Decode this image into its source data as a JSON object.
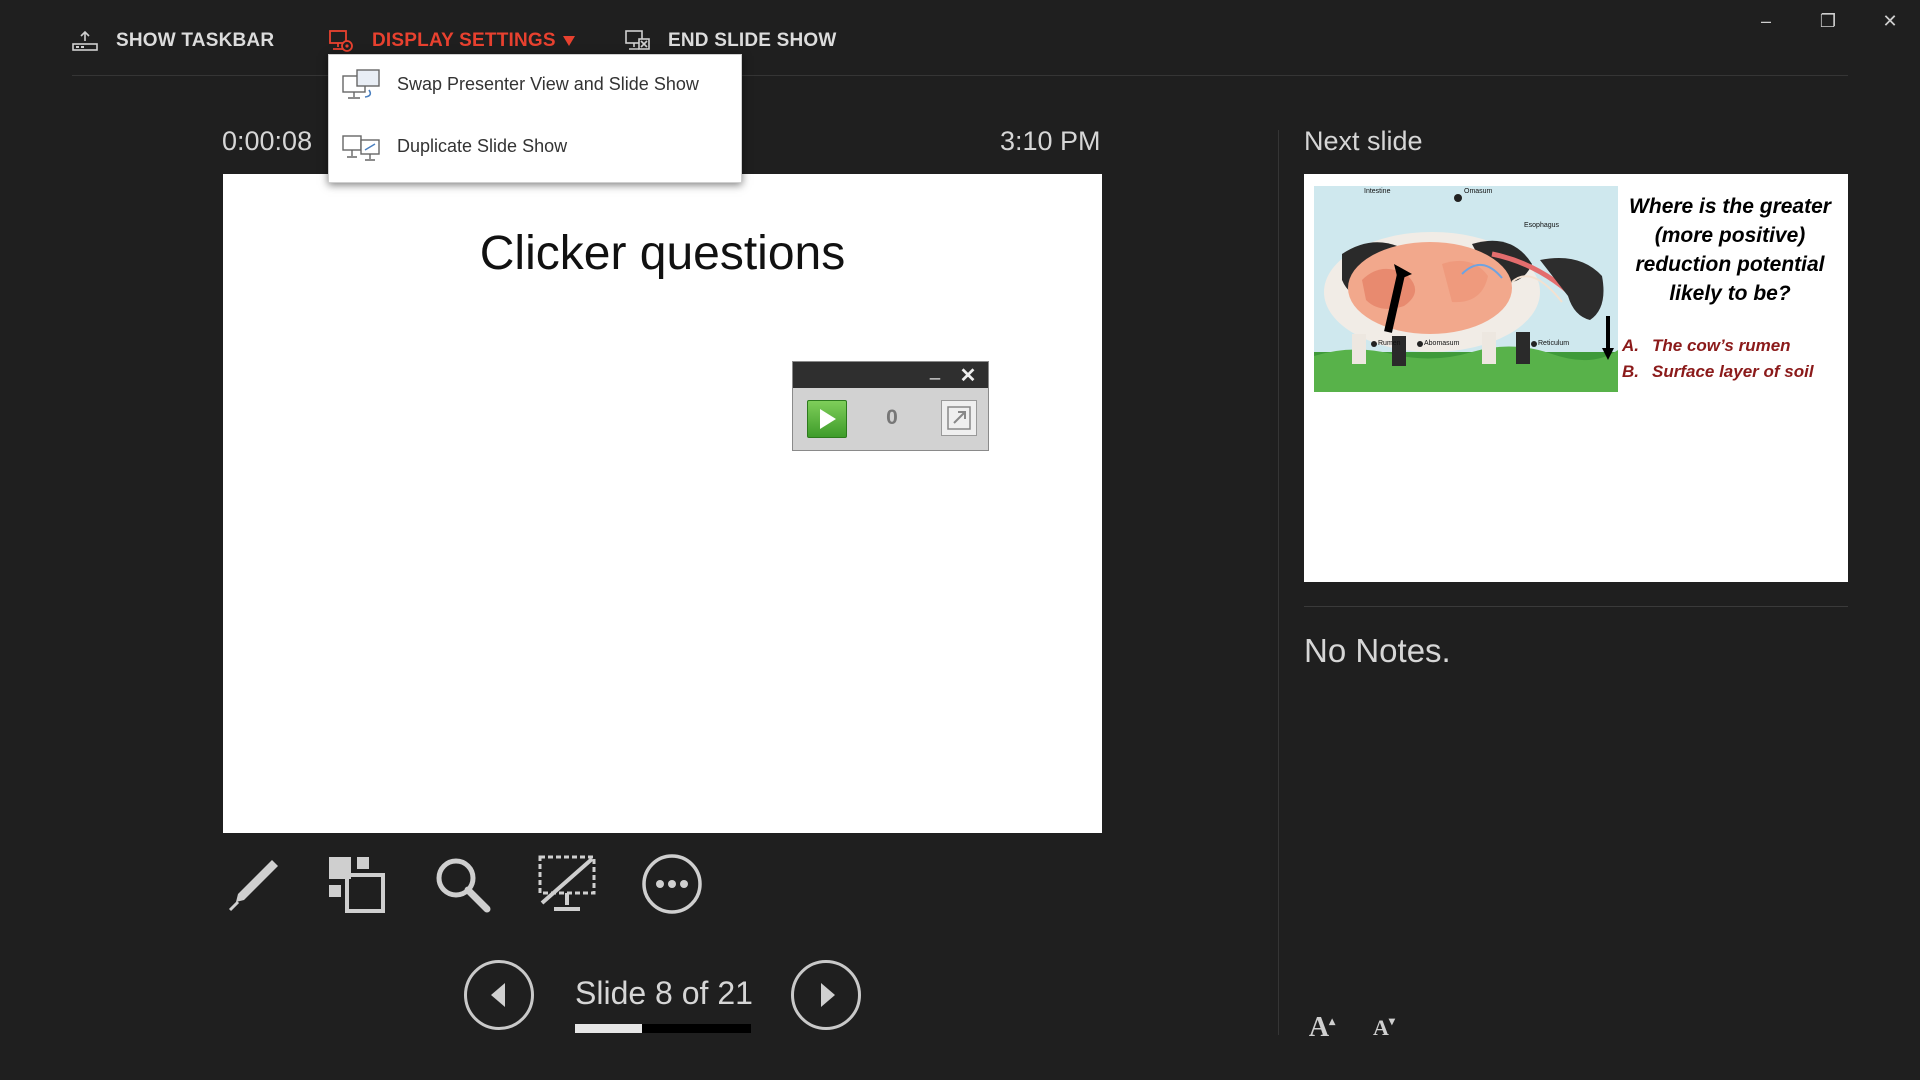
{
  "toolbar": {
    "show_taskbar": "SHOW TASKBAR",
    "display_settings": "DISPLAY SETTINGS",
    "end_slide_show": "END SLIDE SHOW"
  },
  "window_controls": {
    "minimize": "–",
    "restore": "❐",
    "close": "✕"
  },
  "display_menu": {
    "items": [
      {
        "label": "Swap Presenter View and Slide Show",
        "icon": "swap-displays-icon"
      },
      {
        "label": "Duplicate Slide Show",
        "icon": "duplicate-display-icon"
      }
    ]
  },
  "timer": "0:00:08",
  "clock": "3:10 PM",
  "current_slide": {
    "title": "Clicker questions"
  },
  "clicker_widget": {
    "count": "0",
    "minimize": "_",
    "close": "✕"
  },
  "tools": [
    "pen-icon",
    "see-all-slides-icon",
    "zoom-icon",
    "black-screen-icon",
    "more-options-icon"
  ],
  "navigation": {
    "slide_counter": "Slide 8 of 21",
    "current": 8,
    "total": 21,
    "progress_fraction": 0.381
  },
  "next_slide": {
    "label": "Next slide",
    "question": "Where is the greater (more positive) reduction potential likely to be?",
    "answers": [
      {
        "letter": "A.",
        "text": "The cow’s rumen"
      },
      {
        "letter": "B.",
        "text": "Surface layer of soil"
      }
    ],
    "diagram_labels": [
      "Intestine",
      "Omasum",
      "Esophagus",
      "Rumen",
      "Abomasum",
      "Reticulum"
    ]
  },
  "notes": "No Notes.",
  "font_controls": {
    "increase": "A",
    "decrease": "A"
  },
  "colors": {
    "accent": "#e8412f",
    "background": "#1f1f1f",
    "answer_text": "#8b1a1a"
  }
}
